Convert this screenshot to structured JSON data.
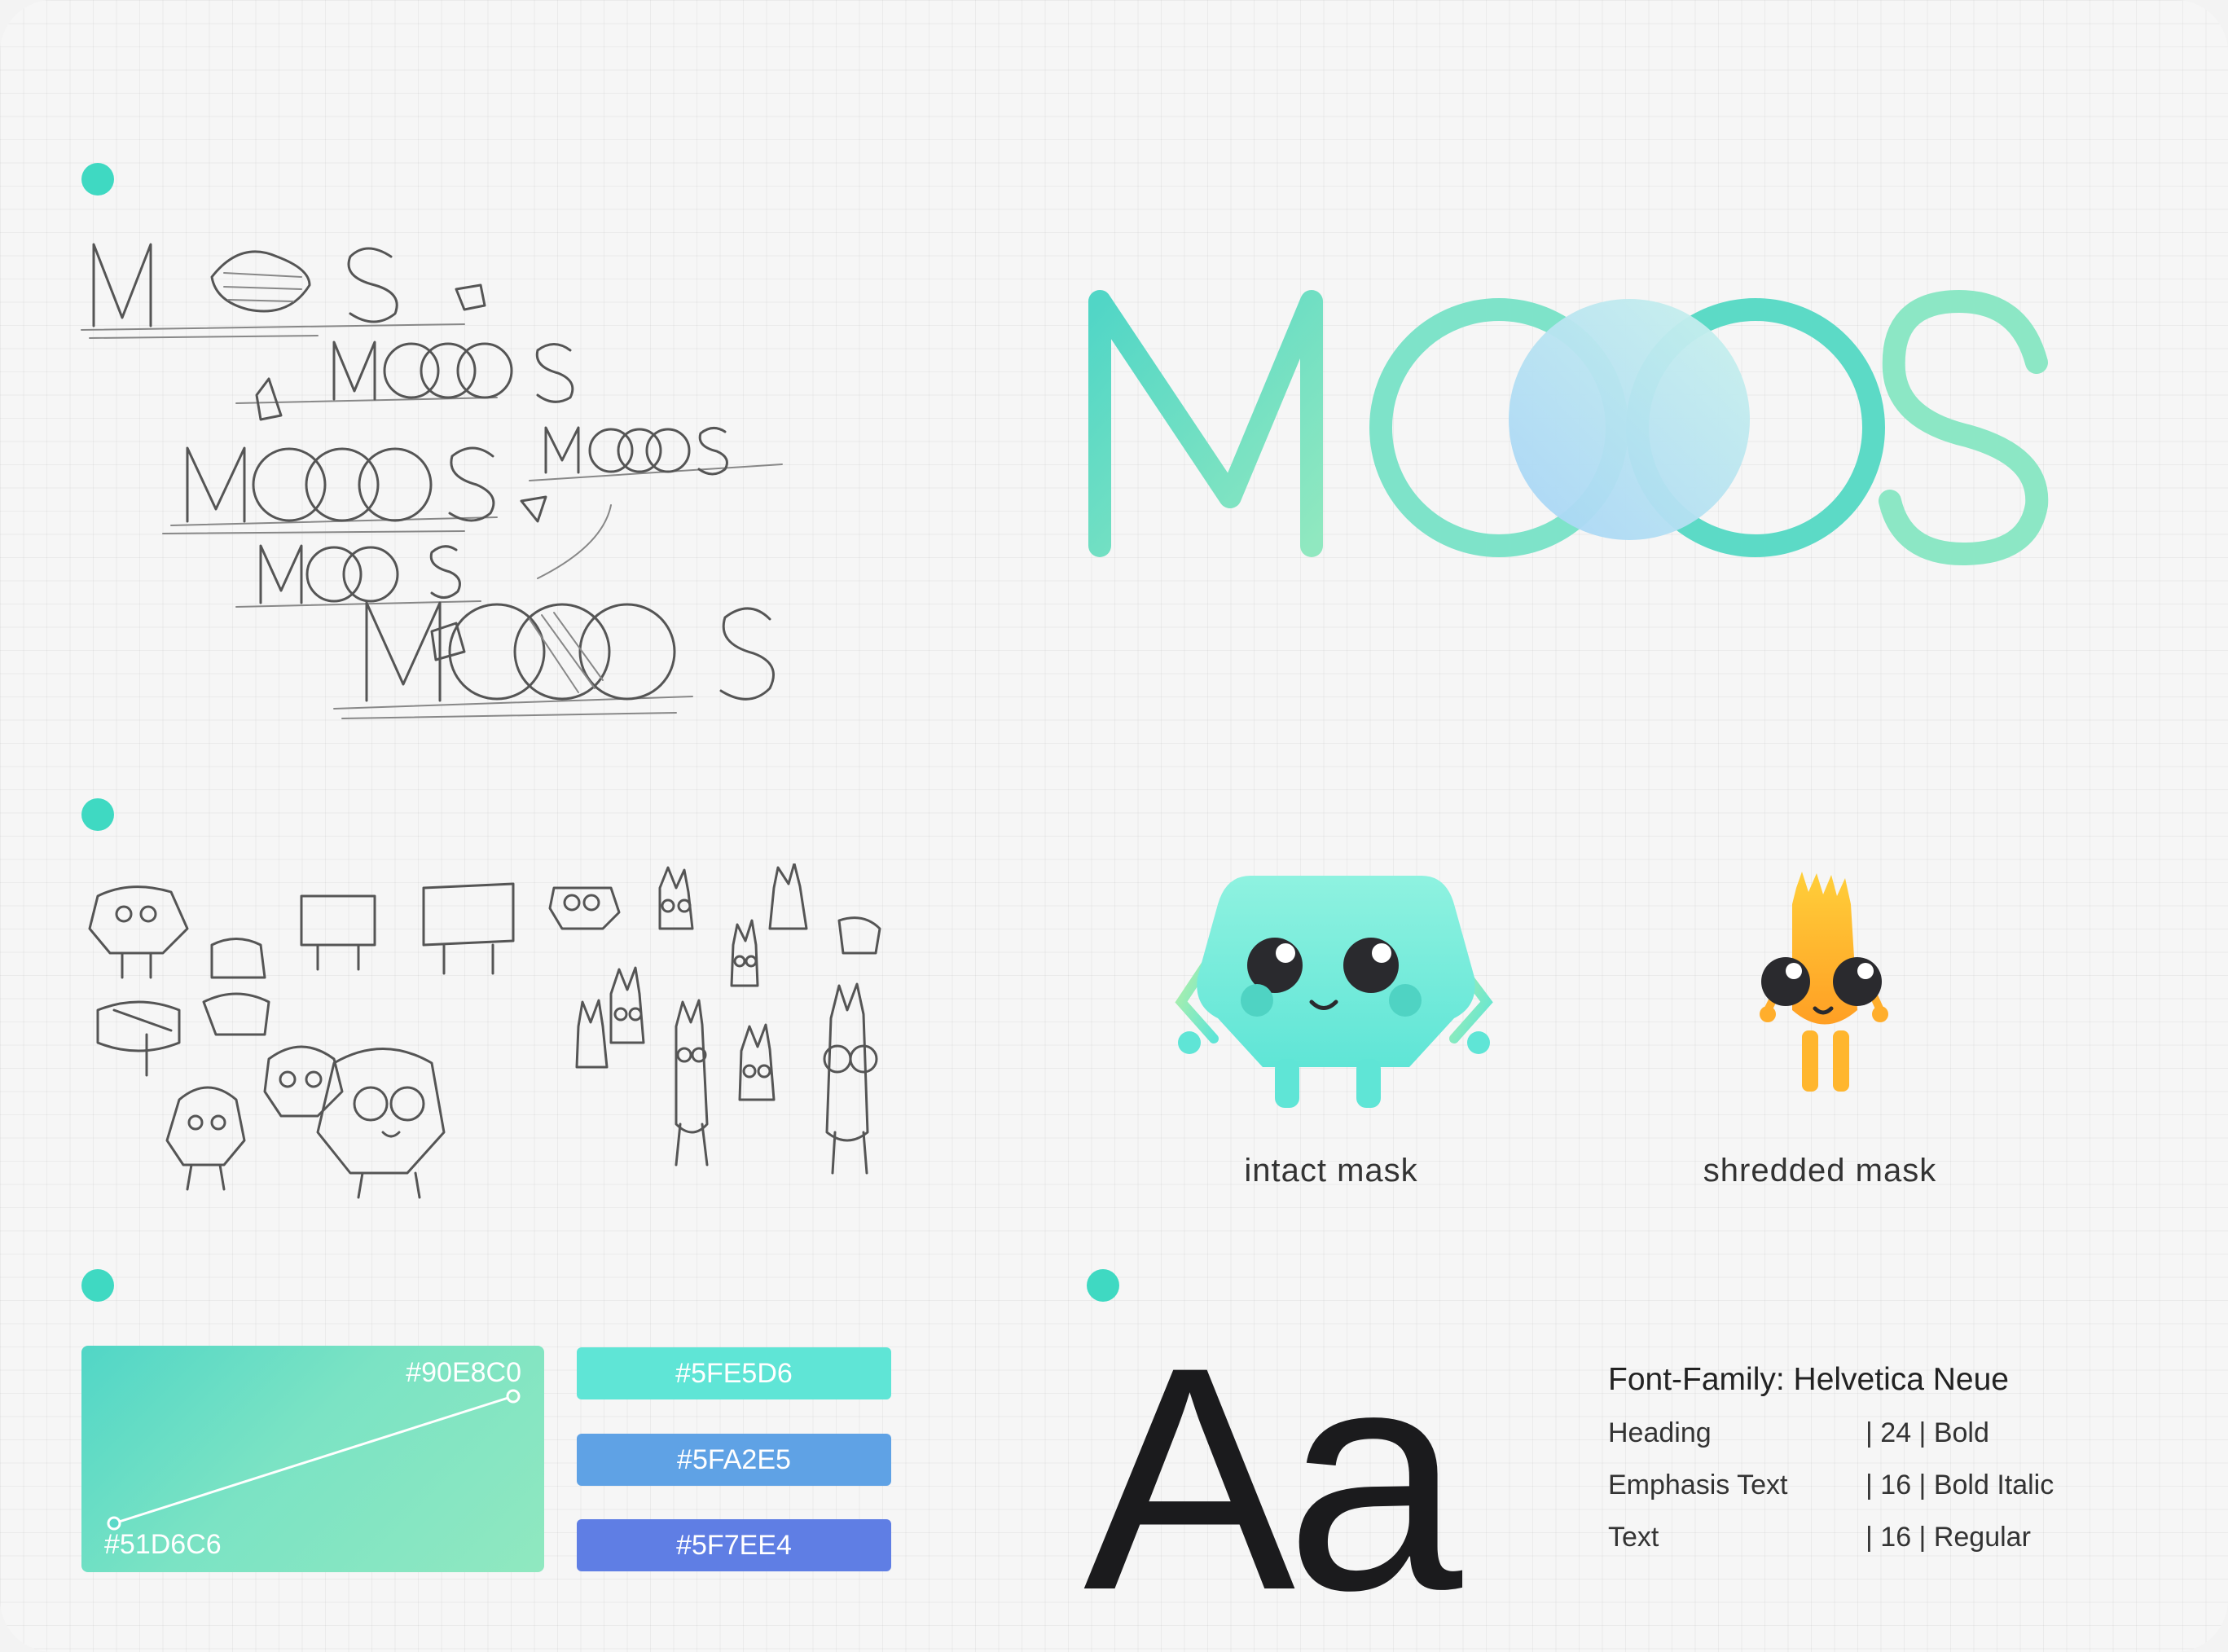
{
  "captions": {
    "intact": "intact mask",
    "shredded": "shredded mask"
  },
  "logo": {
    "text": "MOOS",
    "colors": {
      "teal": "#51d6c6",
      "mint": "#90e8c0",
      "blue": "#5fa2e5"
    }
  },
  "palette": {
    "gradient": {
      "start": "#51D6C6",
      "end": "#90E8C0"
    },
    "swatches": [
      {
        "label": "#5FE5D6",
        "color": "#5FE5D6"
      },
      {
        "label": "#5FA2E5",
        "color": "#5FA2E5"
      },
      {
        "label": "#5F7EE4",
        "color": "#5F7EE4"
      }
    ]
  },
  "typography": {
    "sample": "Aa",
    "family": "Font-Family: Helvetica Neue",
    "rows": [
      {
        "name": "Heading",
        "spec": "| 24 | Bold"
      },
      {
        "name": "Emphasis Text",
        "spec": "| 16 | Bold Italic"
      },
      {
        "name": "Text",
        "spec": "| 16 | Regular"
      }
    ]
  },
  "accent": "#3fd9c2"
}
